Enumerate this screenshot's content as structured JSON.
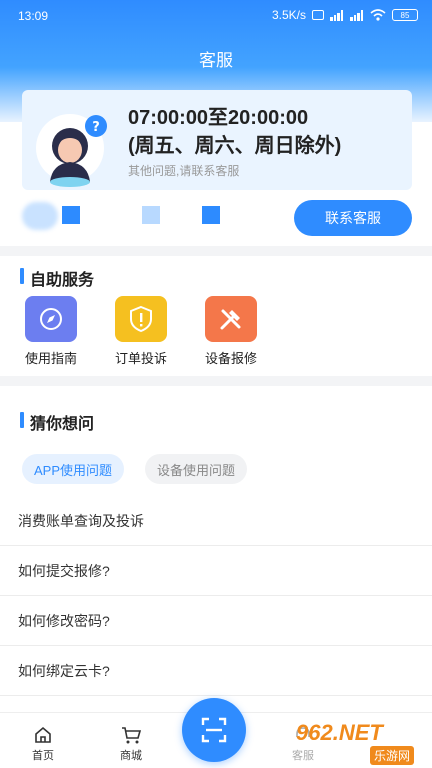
{
  "status_bar": {
    "time": "13:09",
    "network_speed": "3.5K/s",
    "battery": "85"
  },
  "title": "客服",
  "service_card": {
    "hours_line1": "07:00:00至20:00:00",
    "hours_line2": "(周五、周六、周日除外)",
    "note": "其他问题,请联系客服"
  },
  "contact_button": "联系客服",
  "self_service": {
    "title": "自助服务",
    "items": [
      {
        "label": "使用指南",
        "icon": "compass-icon",
        "color": "#6c7ef0"
      },
      {
        "label": "订单投诉",
        "icon": "shield-alert-icon",
        "color": "#f5c020"
      },
      {
        "label": "设备报修",
        "icon": "tools-icon",
        "color": "#f4774a"
      }
    ]
  },
  "guess": {
    "title": "猜你想问",
    "tabs": [
      "APP使用问题",
      "设备使用问题"
    ],
    "questions": [
      "消费账单查询及投诉",
      "如何提交报修?",
      "如何修改密码?",
      "如何绑定云卡?"
    ]
  },
  "tabbar": {
    "home": "首页",
    "mall": "商城",
    "service": "客服",
    "scan_icon": "scan-icon"
  },
  "watermark": {
    "brand": "962.NET",
    "sub": "乐游网"
  },
  "colors": {
    "primary": "#2f8cff"
  }
}
